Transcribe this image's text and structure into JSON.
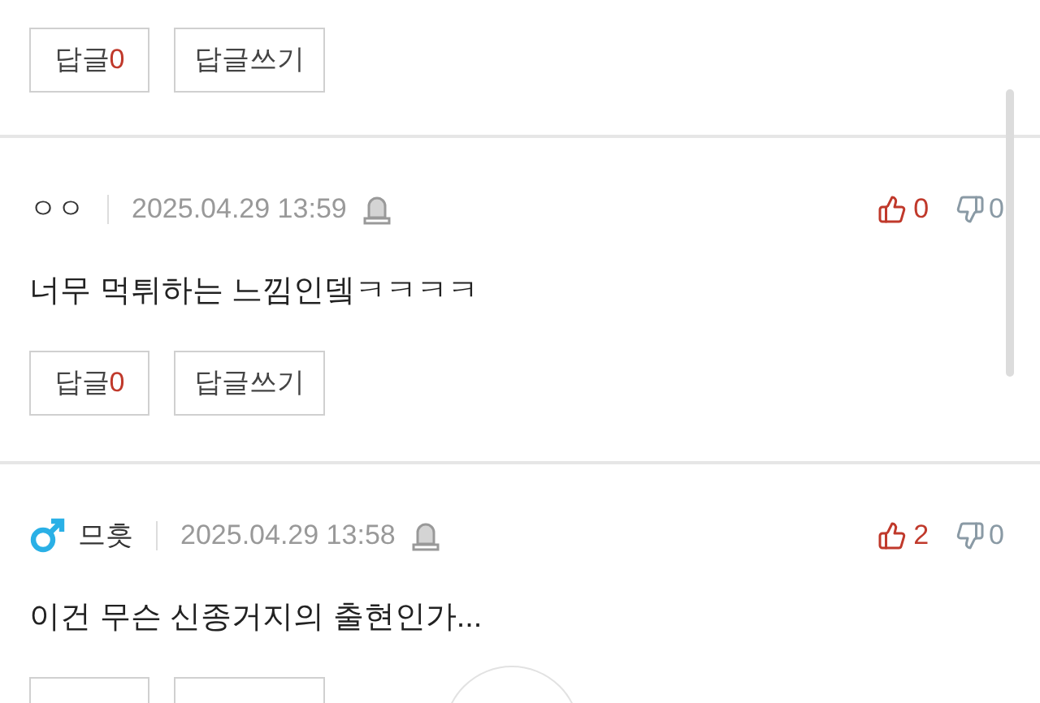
{
  "comments": [
    {
      "reply_label": "답글",
      "reply_count": "0",
      "write_label": "답글쓰기"
    },
    {
      "author": "ㅇㅇ",
      "date": "2025.04.29 13:59",
      "likes": "0",
      "dislikes": "0",
      "text": "너무 먹튀하는 느낌인뎈ㅋㅋㅋㅋ",
      "reply_label": "답글",
      "reply_count": "0",
      "write_label": "답글쓰기"
    },
    {
      "author": "므흣",
      "male": true,
      "date": "2025.04.29 13:58",
      "likes": "2",
      "dislikes": "0",
      "text": "이건 무슨 신종거지의 출현인가..."
    }
  ]
}
